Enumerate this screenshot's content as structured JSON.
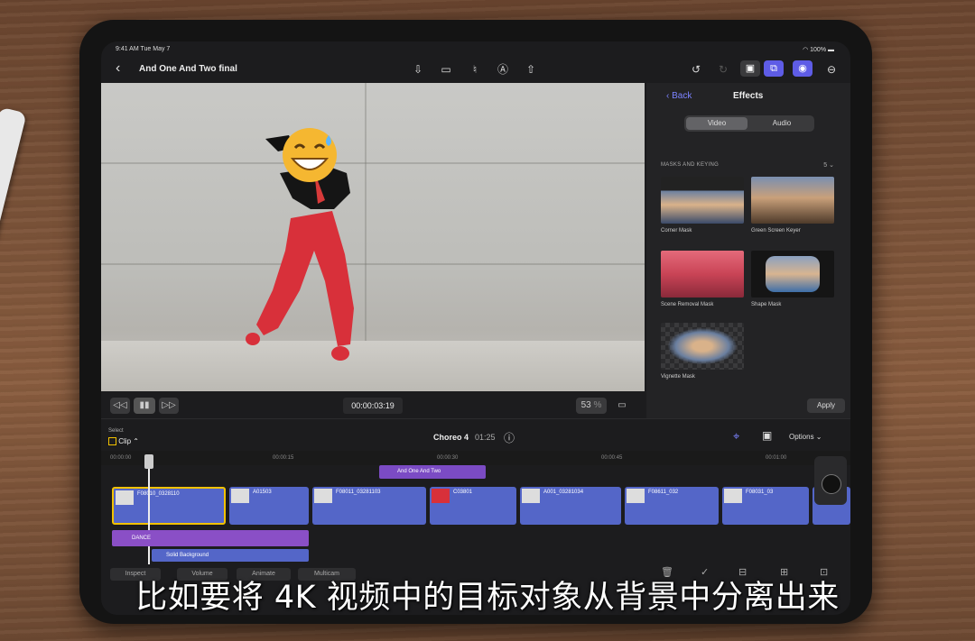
{
  "status": {
    "time": "9:41 AM  Tue May 7",
    "battery": "100%"
  },
  "project": {
    "title": "And One And Two final"
  },
  "viewer": {
    "timecode": "00:00:03:19",
    "zoom": "53",
    "zoom_unit": "%"
  },
  "effects": {
    "back_label": "Back",
    "title": "Effects",
    "tabs": [
      "Video",
      "Audio"
    ],
    "section": "MASKS AND KEYING",
    "section_count": "5",
    "items": [
      "Corner Mask",
      "Green Screen Keyer",
      "Scene Removal Mask",
      "Shape Mask",
      "Vignette Mask"
    ],
    "apply_label": "Apply"
  },
  "timeline": {
    "select_label": "Select",
    "mode": "Clip",
    "project_name": "Choreo 4",
    "duration": "01:25",
    "options_label": "Options",
    "ruler": [
      "00:00:00",
      "00:00:15",
      "00:00:30",
      "00:00:45",
      "00:01:00"
    ],
    "title_clip": "And One And Two",
    "clips": [
      "F08010_0328110",
      "A01503",
      "F08011_03281103",
      "C03801",
      "A001_03281034",
      "F08611_032",
      "F08031_03"
    ],
    "audio_clip": "DANCE",
    "bg_clip": "Solid Background"
  },
  "bottom_tools": [
    "Inspect",
    "Volume",
    "Animate",
    "Multicam"
  ],
  "subtitle": "比如要将 4K 视频中的目标对象从背景中分离出来",
  "colors": {
    "accent": "#5e5ce6",
    "clip": "#5466c8",
    "audio": "#8a4fc6",
    "playhead": "#f2c200"
  }
}
